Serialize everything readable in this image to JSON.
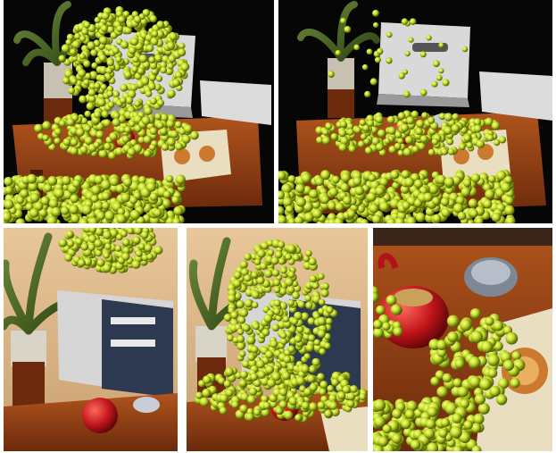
{
  "figure": {
    "panel_count": 5,
    "panels": [
      {
        "id": "p1",
        "depicts": "falling-balls-cascade"
      },
      {
        "id": "p2",
        "depicts": "balls-settled-on-table"
      },
      {
        "id": "p3",
        "depicts": "box-and-teapot-view"
      },
      {
        "id": "p4",
        "depicts": "balls-pouring-over-box"
      },
      {
        "id": "p5",
        "depicts": "teapot-closeup"
      }
    ],
    "ball_color": "#c8e02a",
    "table_color": "#8a3b14",
    "background_color": "#0a0a0a"
  }
}
